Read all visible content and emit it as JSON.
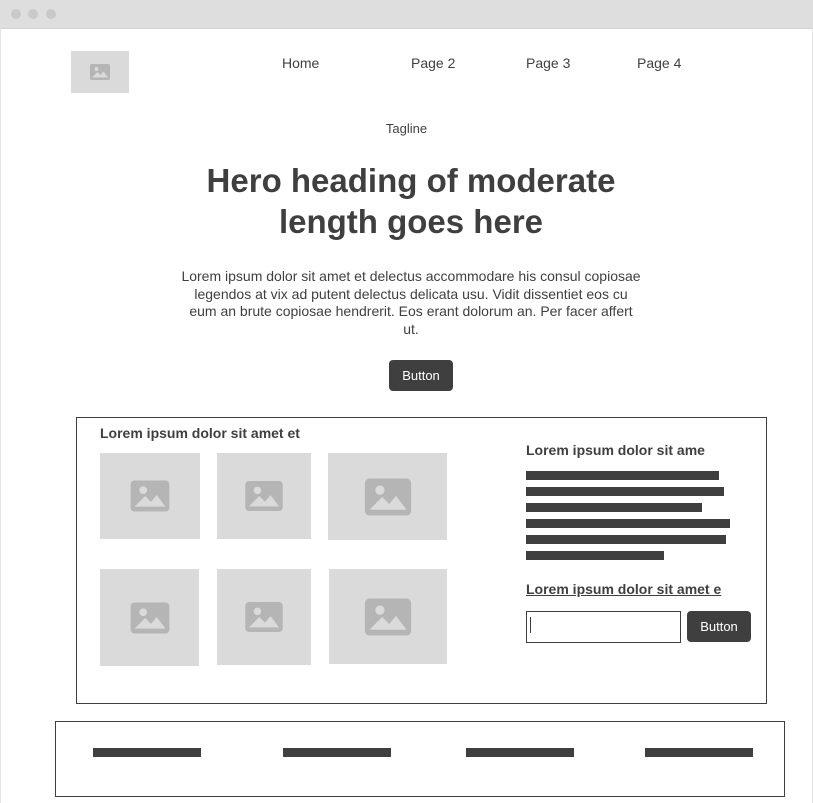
{
  "icons": {
    "logo": "image-placeholder-icon",
    "gallery": "image-placeholder-icon"
  },
  "colors": {
    "dark": "#3f3f3f",
    "placeholder": "#dadada",
    "placeholder_icon": "#b5b5b5",
    "chrome": "#dedede"
  },
  "nav": {
    "items": [
      {
        "label": "Home"
      },
      {
        "label": "Page 2"
      },
      {
        "label": "Page 3"
      },
      {
        "label": "Page 4"
      }
    ]
  },
  "hero": {
    "tagline": "Tagline",
    "heading": "Hero heading of moderate length goes here",
    "body": "Lorem ipsum dolor sit amet et delectus accommodare his consul copiosae legendos at vix ad putent delectus delicata usu. Vidit dissentiet eos cu eum an brute copiosae hendrerit. Eos erant dolorum an. Per facer affert ut.",
    "button_label": "Button"
  },
  "content": {
    "gallery_title": "Lorem ipsum dolor sit amet et",
    "side_title": "Lorem ipsum dolor sit ame",
    "link_text": "Lorem ipsum dolor sit amet e",
    "input_value": "",
    "button_label": "Button"
  }
}
